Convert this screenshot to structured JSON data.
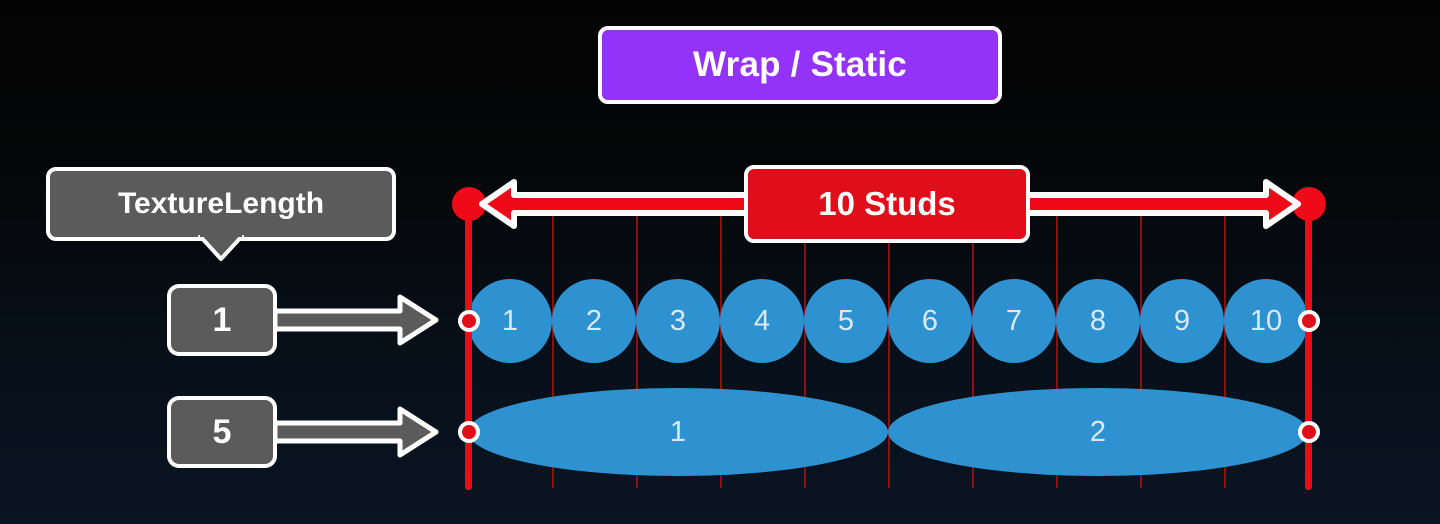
{
  "header": {
    "title": "Wrap / Static",
    "accent_color": "#9333fa"
  },
  "callout": {
    "label": "TextureLength"
  },
  "measurement": {
    "label": "10 Studs",
    "color": "#e00d1a",
    "arrow_icon": "double-arrow-horizontal-icon"
  },
  "rows": [
    {
      "badge": "1",
      "arrow_icon": "arrow-right-icon",
      "shape": "circle",
      "items": [
        "1",
        "2",
        "3",
        "4",
        "5",
        "6",
        "7",
        "8",
        "9",
        "10"
      ]
    },
    {
      "badge": "5",
      "arrow_icon": "arrow-right-icon",
      "shape": "ellipse",
      "items": [
        "1",
        "2"
      ]
    }
  ],
  "track": {
    "segments": 10,
    "left_boundary_icon": "boundary-marker-icon",
    "right_boundary_icon": "boundary-marker-icon",
    "line_color": "#ee0a17",
    "grid_color": "#8c0f14",
    "shape_color": "#2f92d0"
  }
}
